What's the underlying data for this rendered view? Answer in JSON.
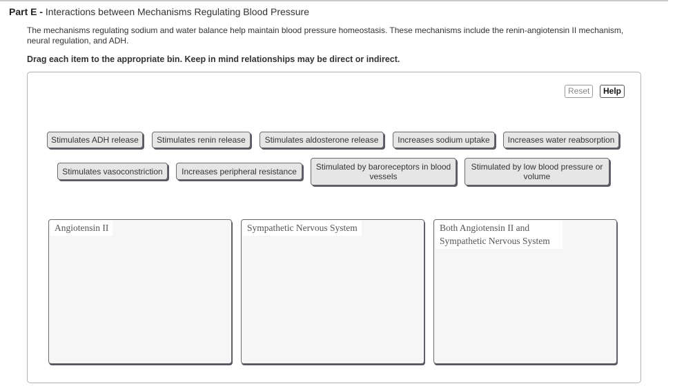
{
  "header": {
    "part_label": "Part E -",
    "part_title": "Interactions between Mechanisms Regulating Blood Pressure"
  },
  "intro": "The mechanisms regulating sodium and water balance help maintain blood pressure homeostasis. These mechanisms include the renin-angiotensin II mechanism, neural regulation, and ADH.",
  "instructions": "Drag each item to the appropriate bin. Keep in mind relationships may be direct or indirect.",
  "toolbar": {
    "reset_label": "Reset",
    "help_label": "Help"
  },
  "items": [
    {
      "label": "Stimulates ADH release"
    },
    {
      "label": "Stimulates renin release"
    },
    {
      "label": "Stimulates aldosterone release"
    },
    {
      "label": "Increases sodium uptake"
    },
    {
      "label": "Increases water reabsorption"
    },
    {
      "label": "Stimulates vasoconstriction"
    },
    {
      "label": "Increases peripheral resistance"
    },
    {
      "label": "Stimulated by baroreceptors in blood vessels"
    },
    {
      "label": "Stimulated by low blood pressure or volume"
    }
  ],
  "bins": [
    {
      "label": "Angiotensin II"
    },
    {
      "label": "Sympathetic Nervous System"
    },
    {
      "label": "Both Angiotensin II and Sympathetic Nervous System"
    }
  ]
}
